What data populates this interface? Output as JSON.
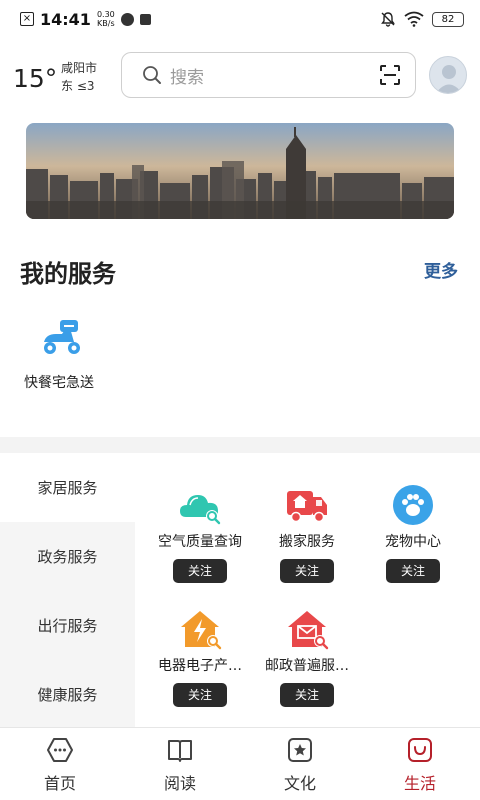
{
  "status_bar": {
    "time": "14:41",
    "net_speed_value": "0.30",
    "net_speed_unit": "KB/s",
    "battery": "82"
  },
  "weather": {
    "temperature": "15°",
    "city": "咸阳市",
    "wind": "东 ≤3"
  },
  "search": {
    "placeholder": "搜索"
  },
  "my_services": {
    "title": "我的服务",
    "more": "更多",
    "items": [
      {
        "label": "快餐宅急送",
        "icon": "delivery-scooter-icon"
      }
    ]
  },
  "categories": [
    {
      "label": "家居服务",
      "active": true
    },
    {
      "label": "政务服务",
      "active": false
    },
    {
      "label": "出行服务",
      "active": false
    },
    {
      "label": "健康服务",
      "active": false
    }
  ],
  "service_grid": [
    {
      "label": "空气质量查询",
      "icon": "cloud-search-icon",
      "follow": "关注",
      "color": "#2fc6b0"
    },
    {
      "label": "搬家服务",
      "icon": "moving-truck-icon",
      "follow": "关注",
      "color": "#e8484a"
    },
    {
      "label": "宠物中心",
      "icon": "paw-icon",
      "follow": "关注",
      "color": "#3aa3e8"
    },
    {
      "label": "电器电子产…",
      "icon": "power-house-icon",
      "follow": "关注",
      "color": "#f29a2b"
    },
    {
      "label": "邮政普遍服…",
      "icon": "mail-house-icon",
      "follow": "关注",
      "color": "#e8484a"
    }
  ],
  "bottom_nav": [
    {
      "label": "首页",
      "icon": "home-hexagon-icon",
      "active": false
    },
    {
      "label": "阅读",
      "icon": "book-icon",
      "active": false
    },
    {
      "label": "文化",
      "icon": "star-frame-icon",
      "active": false
    },
    {
      "label": "生活",
      "icon": "life-smile-icon",
      "active": true
    }
  ],
  "colors": {
    "accent_link": "#2f5f9a",
    "active_tab": "#b5202a",
    "follow_button_bg": "#2b2b2b",
    "service_icon_blue": "#3a9ee8"
  }
}
